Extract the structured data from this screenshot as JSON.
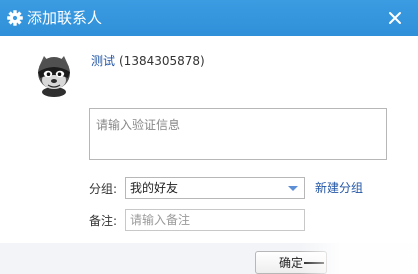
{
  "window": {
    "title": "添加联系人",
    "icons": {
      "title_icon": "gear-icon",
      "close_icon": "close-icon"
    }
  },
  "profile": {
    "nickname": "测试",
    "qq_number": "(1384305878)",
    "avatar": "raccoon-avatar"
  },
  "verification": {
    "text": "请输入验证信息"
  },
  "group": {
    "label": "分组:",
    "selected": "我的好友",
    "new_group_link": "新建分组",
    "icon": "chevron-down-icon"
  },
  "remark": {
    "label": "备注:",
    "placeholder": "请输入备注"
  },
  "footer": {
    "confirm_label": "确定"
  },
  "colors": {
    "titlebar": "#3c9ce2",
    "link": "#2356a5",
    "border": "#b7b7b7",
    "footer": "#f2f4f7"
  }
}
